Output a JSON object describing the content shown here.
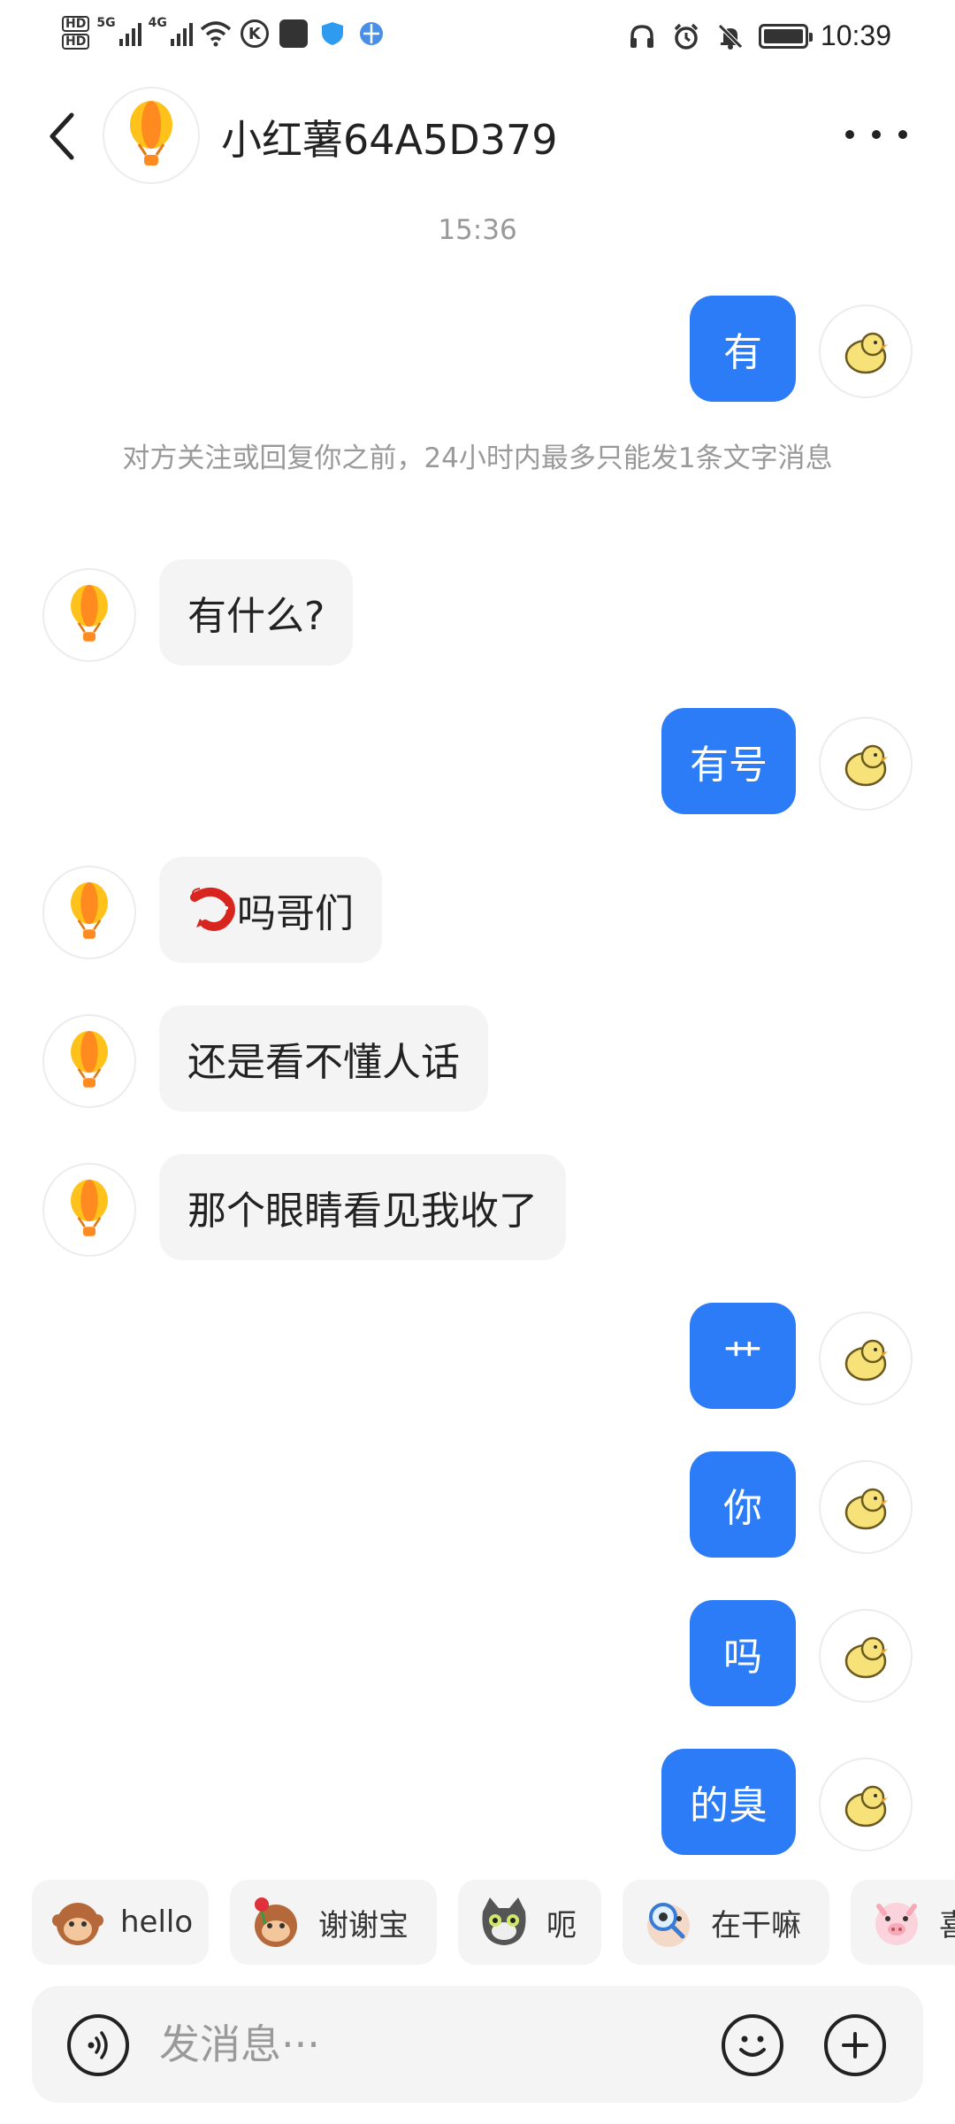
{
  "status_bar": {
    "hd1": "HD",
    "hd2": "HD",
    "net1": "5G",
    "net2": "4G",
    "time": "10:39",
    "icons": [
      "hd-icon",
      "signal-icon",
      "wifi-icon",
      "k-app-icon",
      "bag-icon",
      "shield-icon",
      "browser-icon",
      "headphones-icon",
      "alarm-icon",
      "bell-muted-icon",
      "battery-icon"
    ]
  },
  "header": {
    "title": "小红薯64A5D379",
    "back_icon": "chevron-left-icon",
    "more_icon": "more-dots-icon"
  },
  "chat": {
    "timestamp": "15:36",
    "notice": "对方关注或回复你之前，24小时内最多只能发1条文字消息",
    "messages": [
      {
        "side": "out",
        "text": "有"
      },
      {
        "side": "in",
        "text": "有什么?"
      },
      {
        "side": "out",
        "text": "有号"
      },
      {
        "side": "in",
        "text": "吗哥们",
        "emoji": "shrimp-icon"
      },
      {
        "side": "in",
        "text": "还是看不懂人话"
      },
      {
        "side": "in",
        "text": "那个眼睛看见我收了"
      },
      {
        "side": "out",
        "text": "艹"
      },
      {
        "side": "out",
        "text": "你"
      },
      {
        "side": "out",
        "text": "吗"
      },
      {
        "side": "out",
        "text": "的臭"
      }
    ]
  },
  "stickers": [
    {
      "label": "hello",
      "icon": "monkey-hello-icon"
    },
    {
      "label": "谢谢宝",
      "icon": "monkey-rose-icon"
    },
    {
      "label": "呃",
      "icon": "cat-icon"
    },
    {
      "label": "在干嘛",
      "icon": "magnifier-face-icon"
    },
    {
      "label": "喜",
      "icon": "pig-icon"
    }
  ],
  "input": {
    "placeholder": "发消息···"
  },
  "colors": {
    "accent": "#2b7cf6",
    "bubble_in": "#f4f4f4",
    "meta_text": "#999999"
  }
}
